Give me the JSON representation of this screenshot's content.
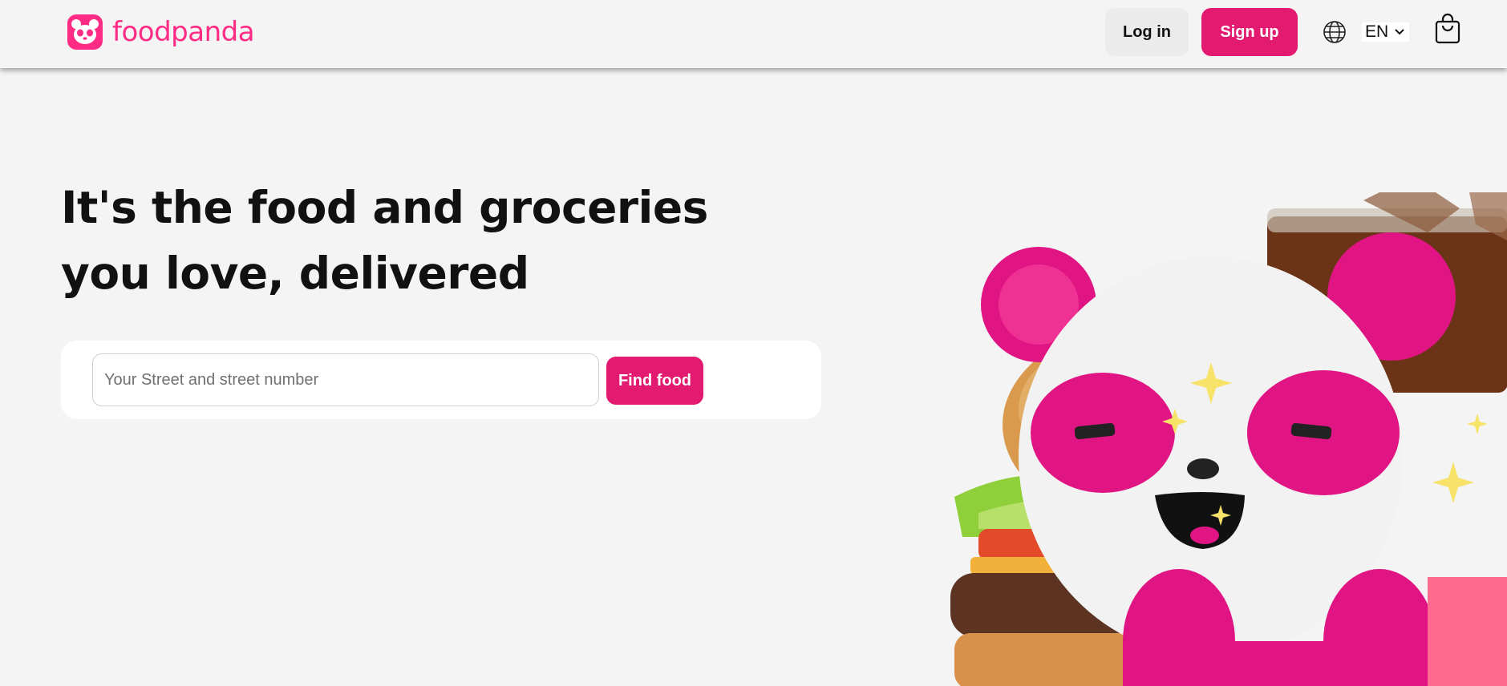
{
  "header": {
    "brand": "foodpanda",
    "login_label": "Log in",
    "signup_label": "Sign up",
    "language": "EN",
    "icons": {
      "logo": "panda-logo-icon",
      "language": "globe-icon",
      "chevron": "chevron-down-icon",
      "cart": "shopping-bag-icon"
    }
  },
  "hero": {
    "headline": "It's the food and groceries you love, delivered",
    "search": {
      "placeholder": "Your Street and street number",
      "value": "",
      "button_label": "Find food"
    }
  },
  "colors": {
    "brand_pink": "#e21b70",
    "logo_pink": "#ff2b85",
    "background": "#f4f4f4"
  }
}
